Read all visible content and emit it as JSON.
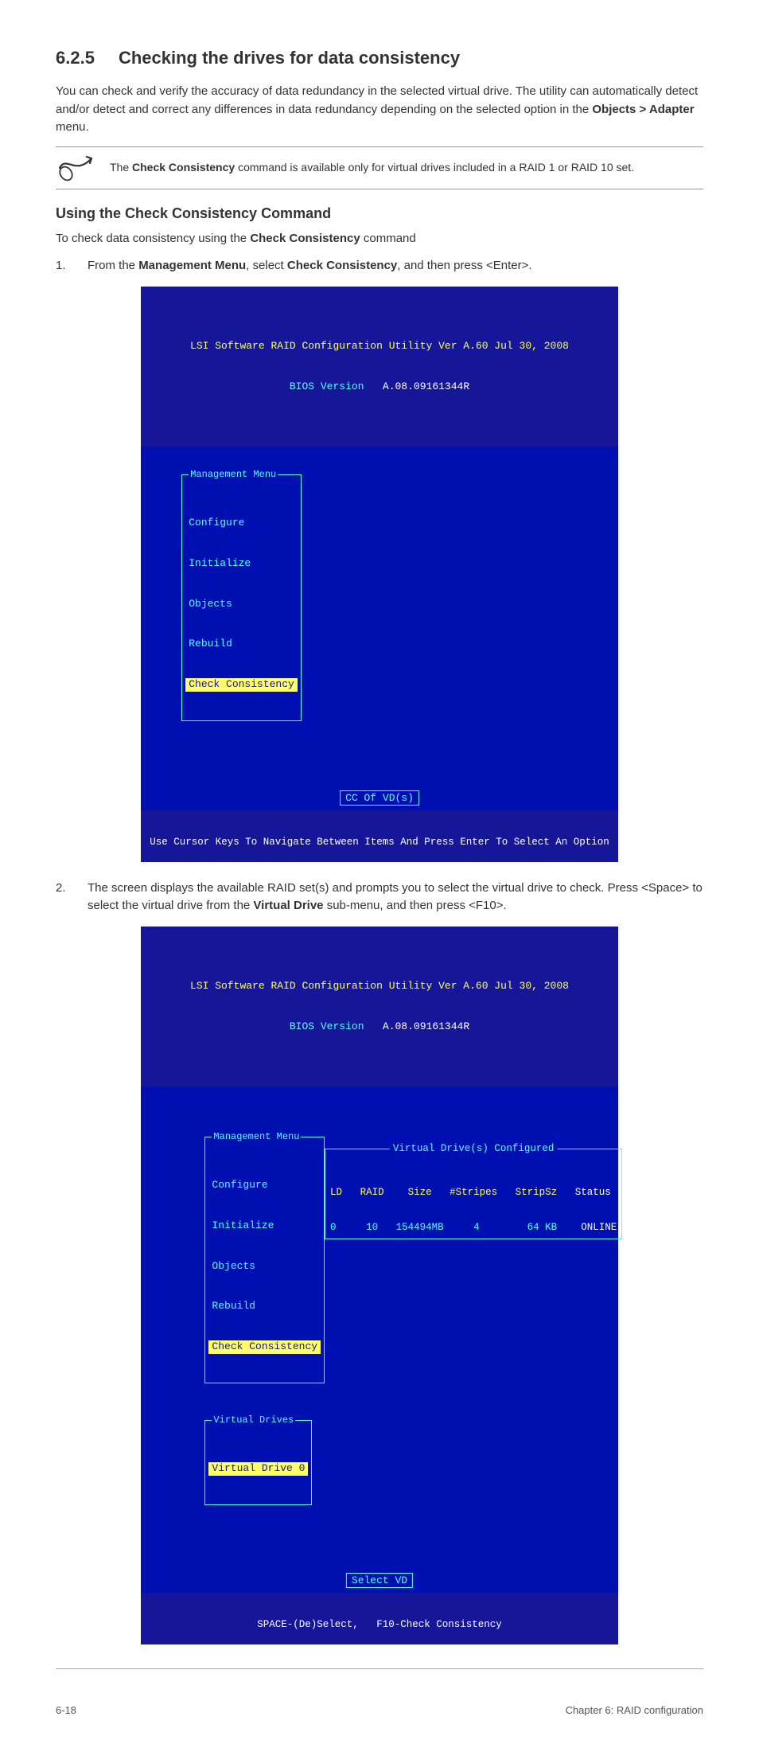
{
  "section": {
    "number": "6.2.5",
    "title": "Checking the drives for data consistency"
  },
  "para1": "You can check and verify the accuracy of data redundancy in the selected virtual drive. The utility can automatically detect and/or detect and correct any differences in data redundancy depending on the selected option in the ",
  "para1_bold": "Objects > Adapter",
  "para1_tail": " menu.",
  "note": {
    "text_prefix": "The ",
    "text_bold": "Check Consistency",
    "text_tail": " command is available only for virtual drives included in a RAID 1 or RAID 10 set."
  },
  "heading2": "Using the Check Consistency Command",
  "para2_prefix": "To check data consistency using the ",
  "para2_bold": "Check Consistency",
  "para2_tail": " command",
  "step1": {
    "num": "1.",
    "prefix": "From the ",
    "b1": "Management Menu",
    "mid": ", select ",
    "b2": "Check Consistency",
    "tail": ", and then press <Enter>."
  },
  "bios_header": {
    "line1": "LSI Software RAID Configuration Utility Ver A.60 Jul 30, 2008",
    "line2_label": "BIOS Version",
    "line2_value": "A.08.09161344R"
  },
  "menu": {
    "title": "Management Menu",
    "items": [
      "Configure",
      "Initialize",
      "Objects",
      "Rebuild",
      "Check Consistency"
    ],
    "highlighted": 4
  },
  "action1": "CC Of VD(s)",
  "footer1": "Use Cursor Keys To Navigate Between Items And Press Enter To Select An Option",
  "step2": {
    "num": "2.",
    "prefix": "The screen displays the available RAID set(s) and prompts you to select the virtual drive to check. Press <Space> to select the virtual drive from the ",
    "b1": "Virtual Drive",
    "tail": " sub-menu, and then press <F10>."
  },
  "vd_panel": {
    "title": "Virtual Drive(s) Configured",
    "headers": [
      "LD",
      "RAID",
      "Size",
      "#Stripes",
      "StripSz",
      "Status"
    ],
    "row": [
      "0",
      "10",
      "154494MB",
      "4",
      "64 KB",
      "ONLINE"
    ]
  },
  "vd_sub": {
    "title": "Virtual Drives",
    "item": "Virtual Drive 0"
  },
  "action2": "Select VD",
  "footer2_left": "SPACE-(De)Select,",
  "footer2_right": "F10-Check Consistency",
  "pagefoot": {
    "left": "6-18",
    "right": "Chapter 6: RAID configuration"
  }
}
